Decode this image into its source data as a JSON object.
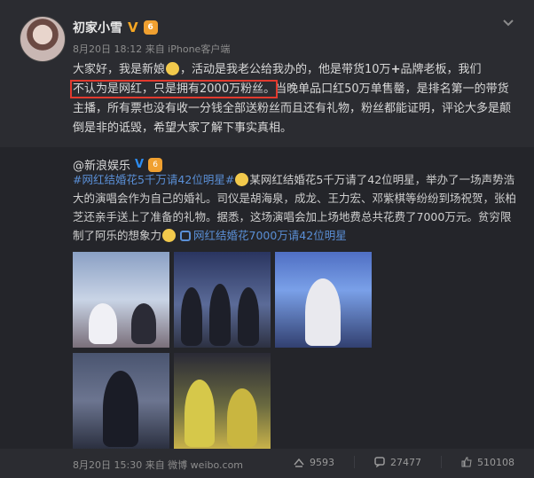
{
  "post": {
    "author": "初家小雪",
    "v_badge": "V",
    "level_badge": "6",
    "meta": "8月20日 18:12 来自 iPhone客户端",
    "text_before": "大家好，我是新娘",
    "text_after_emoji": "，活动是我老公给我办的，他是带货10万",
    "text_plus": "+",
    "text_mid": "品牌老板，我们",
    "highlight": "不认为是网红，只是拥有2000万粉丝。",
    "text_rest": "当晚单品口红50万单售罄，是排名第一的带货主播，所有票也没有收一分钱全部送粉丝而且还有礼物，粉丝都能证明，评论大多是颠倒是非的诋毁，希望大家了解下事实真相。"
  },
  "repost": {
    "author": "@新浪娱乐",
    "v_badge": "V",
    "level_badge": "6",
    "tag1": "#网红结婚花5千万请42位明星#",
    "text1": "某网红结婚花5千万请了42位明星，举办了一场声势浩大的演唱会作为自己的婚礼。司仪是胡海泉，成龙、王力宏、邓紫棋等纷纷到场祝贺，张柏芝还亲手送上了准备的礼物。据悉，这场演唱会加上场地费总共花费了7000万元。贫穷限制了阿乐的想象力",
    "link": "网红结婚花7000万请42位明星"
  },
  "footer": {
    "time": "8月20日 15:30 来自 微博 weibo.com",
    "reposts": "9593",
    "comments": "27477",
    "likes": "510108"
  }
}
